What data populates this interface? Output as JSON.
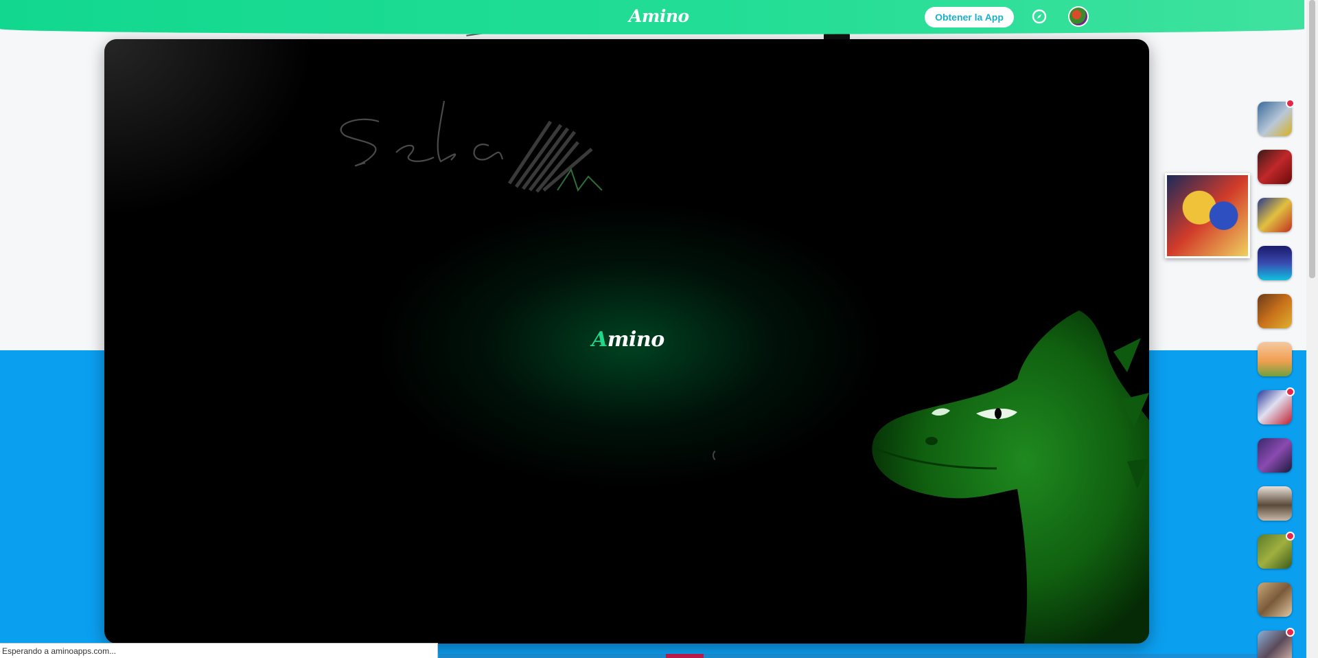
{
  "header": {
    "logo": "Amino",
    "get_app_label": "Obtener la App",
    "colors": {
      "brand": "#1fdc93",
      "button_text": "#1ab1c8"
    }
  },
  "modal": {
    "logo_prefix": "A",
    "logo_rest": "mino",
    "signature_text": "Seba"
  },
  "communities": [
    {
      "name": "community-1",
      "notification": true
    },
    {
      "name": "community-2",
      "notification": false
    },
    {
      "name": "community-3",
      "notification": false,
      "active": true
    },
    {
      "name": "community-4",
      "notification": false
    },
    {
      "name": "community-5",
      "notification": false
    },
    {
      "name": "community-6",
      "notification": false
    },
    {
      "name": "community-7",
      "notification": true
    },
    {
      "name": "community-8",
      "notification": false
    },
    {
      "name": "community-9",
      "notification": false
    },
    {
      "name": "community-10",
      "notification": true
    },
    {
      "name": "community-11",
      "notification": false
    },
    {
      "name": "community-12",
      "notification": true
    }
  ],
  "status_bar": {
    "text": "Esperando a aminoapps.com..."
  }
}
